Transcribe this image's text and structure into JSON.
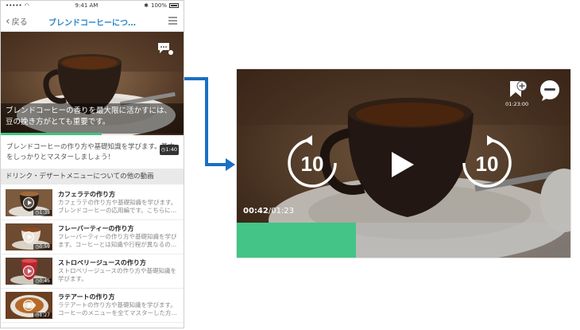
{
  "phone": {
    "status": {
      "carrier": "•••••",
      "time": "9:41 AM",
      "battery": "100%"
    },
    "nav": {
      "back_label": "戻る",
      "title": "ブレンドコーヒーにつ…"
    },
    "hero": {
      "caption": "ブレンドコーヒーの香りを最大限に活かすには、豆の挽き方がとても重要です。",
      "progress": 0.55
    },
    "description": {
      "text": "ブレンドコーヒーの作り方や基礎知識を学びます。基本をしっかりとマスターしましょう！",
      "duration": "1:40"
    },
    "section_title": "ドリンク・デザートメニューについての他の動画",
    "items": [
      {
        "title": "カフェラテの作り方",
        "desc": "カフェラテの作り方や基礎知識を学びます。ブレンドコーヒーの応用編です。こちらに…",
        "duration": "1:35"
      },
      {
        "title": "フレーバーティーの作り方",
        "desc": "フレーバーティーの作り方や基礎知識を学びます。コーヒーとは知識や行程が異なるの…",
        "duration": "0:59"
      },
      {
        "title": "ストロベリージュースの作り方",
        "desc": "ストロベリージュースの作り方や基礎知識を学びます。",
        "duration": "0:45"
      },
      {
        "title": "ラテアートの作り方",
        "desc": "ラテアートの作り方や基礎知識を学びます。コーヒーのメニューを全てマスターした方…",
        "duration": "1:27"
      }
    ]
  },
  "player": {
    "current_time": "00:42",
    "total_time": "/01:23",
    "bookmark_time": "01:23:00",
    "rewind_label": "10",
    "forward_label": "10",
    "progress": 0.357
  },
  "colors": {
    "accent_blue": "#2a86c8",
    "progress_green": "#44c486",
    "arrow_blue": "#1a6fc4"
  }
}
